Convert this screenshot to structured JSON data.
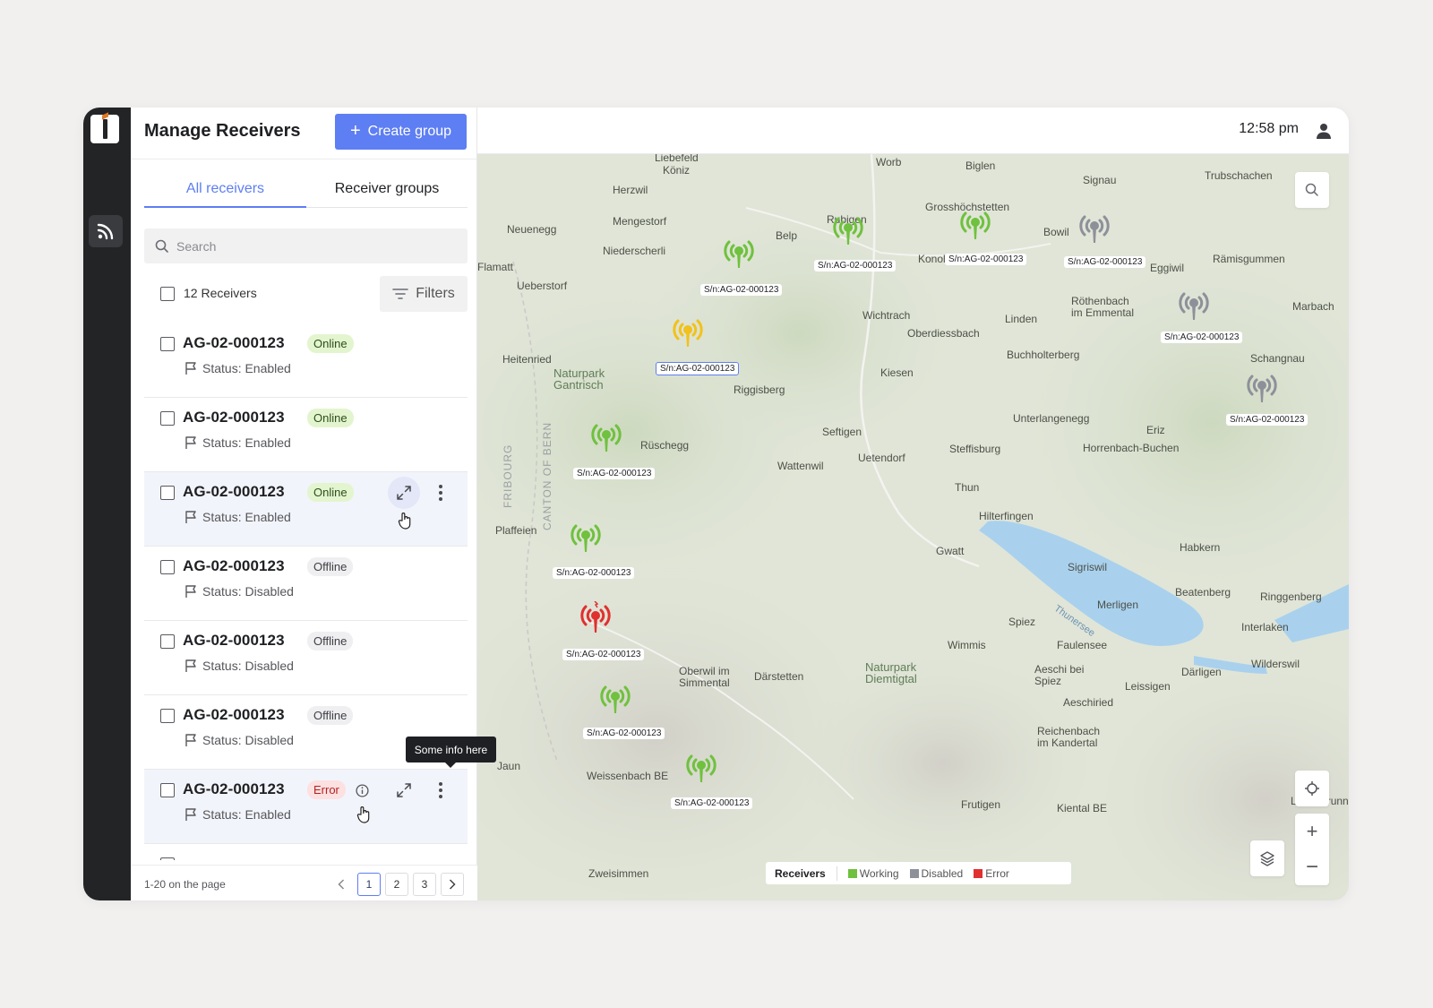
{
  "panel": {
    "title": "Manage Receivers",
    "create_label": "Create group",
    "tabs": [
      "All receivers",
      "Receiver groups"
    ],
    "search_placeholder": "Search",
    "count_label": "12 Receivers",
    "filters_label": "Filters"
  },
  "rows": [
    {
      "id": "AG-02-000123",
      "badge": "Online",
      "status": "Status: Enabled"
    },
    {
      "id": "AG-02-000123",
      "badge": "Online",
      "status": "Status: Enabled"
    },
    {
      "id": "AG-02-000123",
      "badge": "Online",
      "status": "Status: Enabled"
    },
    {
      "id": "AG-02-000123",
      "badge": "Offline",
      "status": "Status: Disabled"
    },
    {
      "id": "AG-02-000123",
      "badge": "Offline",
      "status": "Status: Disabled"
    },
    {
      "id": "AG-02-000123",
      "badge": "Offline",
      "status": "Status: Disabled"
    },
    {
      "id": "AG-02-000123",
      "badge": "Error",
      "status": "Status: Enabled"
    }
  ],
  "tooltip": "Some info here",
  "pager": {
    "range": "1-20 on the page",
    "pages": [
      "1",
      "2",
      "3"
    ],
    "active": "1"
  },
  "topbar": {
    "time": "12:58 pm"
  },
  "map": {
    "places": [
      "Liebefeld",
      "Köniz",
      "Worb",
      "Biglen",
      "Signau",
      "Trubschachen",
      "Herzwil",
      "Mengestorf",
      "Neuenegg",
      "Niederscherli",
      "Belp",
      "Rubigen",
      "Grosshöchstetten",
      "Bowil",
      "Konolfi",
      "Eggiwil",
      "Rämisgummen",
      "Flamatt",
      "Ueberstorf",
      "Wichtrach",
      "Oberdiessbach",
      "Röthenbach im Emmental",
      "Linden",
      "Marbach",
      "Heitenried",
      "Buchholterberg",
      "Schangnau",
      "Kiesen",
      "Naturpark Gantrisch",
      "Riggisberg",
      "Rüschegg",
      "Seftigen",
      "Uetendorf",
      "Unterlangenegg",
      "Eriz",
      "Wattenwil",
      "Steffisburg",
      "Horrenbach-Buchen",
      "Thun",
      "Hilterfingen",
      "Plaffeien",
      "Gwatt",
      "Sigriswil",
      "Habkern",
      "Merligen",
      "Beatenberg",
      "Ringgenberg",
      "Spiez",
      "Faulensee",
      "Interlaken",
      "Wimmis",
      "Oberwil im Simmental",
      "Därstetten",
      "Naturpark Diemtigtal",
      "Aeschi bei Spiez",
      "Leissigen",
      "Därligen",
      "Wilderswil",
      "Aeschiried",
      "Reichenbach im Kandertal",
      "Jaun",
      "Weissenbach BE",
      "Frutigen",
      "Kiental BE",
      "Zweisimmen",
      "Lauterbrunnen",
      "Thunersee",
      "FRIBOURG",
      "CANTON OF BERN",
      "Heitenried"
    ],
    "marker_label": "S/n:AG-02-000123",
    "markers": [
      {
        "status": "Working"
      },
      {
        "status": "Working"
      },
      {
        "status": "Working"
      },
      {
        "status": "Disabled"
      },
      {
        "status": "Disabled"
      },
      {
        "status": "Disabled"
      },
      {
        "status": "Pending"
      },
      {
        "status": "Working"
      },
      {
        "status": "Working"
      },
      {
        "status": "Error"
      },
      {
        "status": "Working"
      },
      {
        "status": "Working"
      }
    ]
  },
  "legend": {
    "title": "Receivers",
    "items": [
      {
        "label": "Working",
        "color": "#6fc13e"
      },
      {
        "label": "Disabled",
        "color": "#8e9099"
      },
      {
        "label": "Error",
        "color": "#e0302f"
      }
    ]
  },
  "colors": {
    "accent": "#5e7ef3",
    "working": "#6fc13e",
    "disabled": "#8e9099",
    "error": "#e0302f",
    "pending": "#f1c21b"
  }
}
